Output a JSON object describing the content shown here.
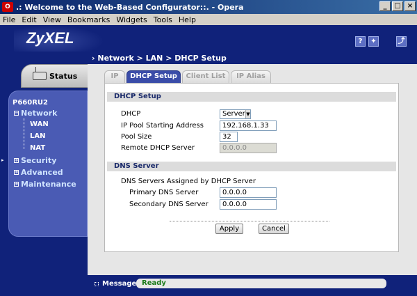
{
  "window": {
    "title": ".: Welcome to the Web-Based Configurator::. - Opera",
    "app_icon": "O"
  },
  "menu": [
    {
      "label": "File"
    },
    {
      "label": "Edit"
    },
    {
      "label": "View"
    },
    {
      "label": "Bookmarks"
    },
    {
      "label": "Widgets"
    },
    {
      "label": "Tools"
    },
    {
      "label": "Help"
    }
  ],
  "header": {
    "logo": "ZyXEL",
    "help_icon_glyph": "?",
    "wizard_icon_glyph": "✦",
    "logout_icon_glyph": "⤴"
  },
  "breadcrumb": "Network > LAN > DHCP Setup",
  "sidebar": {
    "status_label": "Status",
    "model": "P660RU2",
    "items": [
      {
        "label": "Network",
        "expanded": true
      },
      {
        "label": "Security",
        "expanded": false
      },
      {
        "label": "Advanced",
        "expanded": false
      },
      {
        "label": "Maintenance",
        "expanded": false
      }
    ],
    "network_sub": [
      {
        "label": "WAN"
      },
      {
        "label": "LAN"
      },
      {
        "label": "NAT"
      }
    ]
  },
  "tabs": [
    {
      "label": "IP",
      "active": false
    },
    {
      "label": "DHCP Setup",
      "active": true
    },
    {
      "label": "Client List",
      "active": false
    },
    {
      "label": "IP Alias",
      "active": false
    }
  ],
  "dhcp_setup": {
    "section_title": "DHCP Setup",
    "dhcp_label": "DHCP",
    "dhcp_value": "Server",
    "pool_start_label": "IP Pool Starting Address",
    "pool_start_value": "192.168.1.33",
    "pool_size_label": "Pool Size",
    "pool_size_value": "32",
    "remote_label": "Remote DHCP Server",
    "remote_value": "0.0.0.0"
  },
  "dns_server": {
    "section_title": "DNS Server",
    "assigned_label": "DNS Servers Assigned by DHCP Server",
    "primary_label": "Primary DNS Server",
    "primary_value": "0.0.0.0",
    "secondary_label": "Secondary DNS Server",
    "secondary_value": "0.0.0.0"
  },
  "buttons": {
    "apply": "Apply",
    "cancel": "Cancel"
  },
  "status": {
    "label": "Message",
    "value": "Ready"
  },
  "colors": {
    "navy": "#10227a",
    "nav_panel": "#4a5bb4",
    "active_tab": "#3a4ca8",
    "status_ready": "#1a7a1a"
  }
}
